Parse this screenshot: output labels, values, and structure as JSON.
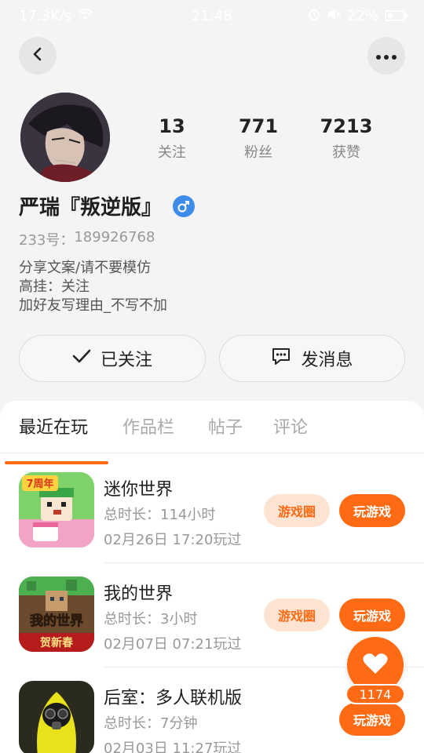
{
  "status_bar": {
    "speed": "17.3K/s",
    "time": "21:48",
    "battery": "22%"
  },
  "profile": {
    "nickname": "严瑞『叛逆版』",
    "uid_label": "233号：",
    "uid": "189926768",
    "bio": [
      "分享文案/请不要模仿",
      "高挂：关注",
      "加好友写理由_不写不加"
    ],
    "stats": [
      {
        "value": "13",
        "label": "关注"
      },
      {
        "value": "771",
        "label": "粉丝"
      },
      {
        "value": "7213",
        "label": "获赞"
      }
    ]
  },
  "actions": {
    "follow_label": "已关注",
    "message_label": "发消息"
  },
  "tabs": [
    "最近在玩",
    "作品栏",
    "帖子",
    "评论"
  ],
  "games": [
    {
      "title": "迷你世界",
      "duration": "总时长：114小时",
      "played": "02月26日 17:20玩过",
      "circle_label": "游戏圈",
      "play_label": "玩游戏",
      "badge": "7周年"
    },
    {
      "title": "我的世界",
      "duration": "总时长：3小时",
      "played": "02月07日 07:21玩过",
      "circle_label": "游戏圈",
      "play_label": "玩游戏",
      "badge": "我的世界",
      "sub_badge": "贺新春"
    },
    {
      "title": "后室：多人联机版",
      "duration": "总时长：7分钟",
      "played": "02月03日 11:27玩过",
      "play_label": "玩游戏"
    }
  ],
  "likes": {
    "count": "1174"
  },
  "colors": {
    "accent": "#ff6a13",
    "gender_male": "#3e8ce9",
    "circle_bg": "#fde3d2"
  },
  "icons": [
    "back-icon",
    "more-icon",
    "male-icon",
    "check-icon",
    "chat-icon",
    "heart-icon",
    "wifi-icon",
    "mute-icon",
    "battery-icon"
  ]
}
